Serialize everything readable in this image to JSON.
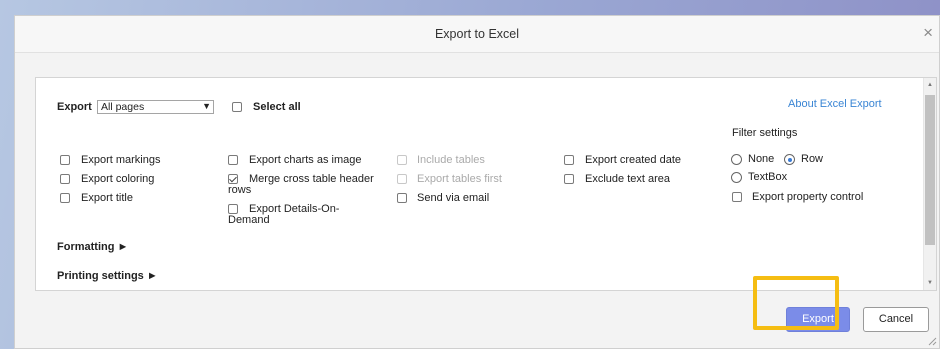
{
  "dialog": {
    "title": "Export to Excel",
    "close_icon": "×"
  },
  "export_row": {
    "label": "Export",
    "selected_option": "All pages",
    "select_all_label": "Select all",
    "about_link": "About Excel Export"
  },
  "filter_settings": {
    "heading": "Filter settings",
    "options": [
      {
        "label": "None",
        "selected": false
      },
      {
        "label": "Row",
        "selected": true
      },
      {
        "label": "TextBox",
        "selected": false
      }
    ],
    "export_property_control": "Export property control"
  },
  "column1": [
    {
      "label": "Export markings",
      "checked": false,
      "disabled": false
    },
    {
      "label": "Export coloring",
      "checked": false,
      "disabled": false
    },
    {
      "label": "Export title",
      "checked": false,
      "disabled": false
    }
  ],
  "column2": {
    "charts_as_image": {
      "label": "Export charts as image",
      "checked": false
    },
    "merge_header": {
      "line1": "Merge cross table header",
      "line2": "rows",
      "checked": true
    },
    "details_on_demand": {
      "line1": "Export Details-On-",
      "line2": "Demand",
      "checked": false
    }
  },
  "column3": [
    {
      "label": "Include tables",
      "checked": false,
      "disabled": true
    },
    {
      "label": "Export tables first",
      "checked": false,
      "disabled": true
    },
    {
      "label": "Send via email",
      "checked": false,
      "disabled": false
    }
  ],
  "column4": [
    {
      "label": "Export created date",
      "checked": false,
      "disabled": false
    },
    {
      "label": "Exclude text area",
      "checked": false,
      "disabled": false
    }
  ],
  "sections": {
    "formatting": "Formatting ►",
    "printing": "Printing settings ►"
  },
  "buttons": {
    "export": "Export",
    "cancel": "Cancel"
  },
  "colors": {
    "accent_button": "#7b8ce8",
    "highlight": "#f5bd12",
    "link": "#3a85d4"
  }
}
